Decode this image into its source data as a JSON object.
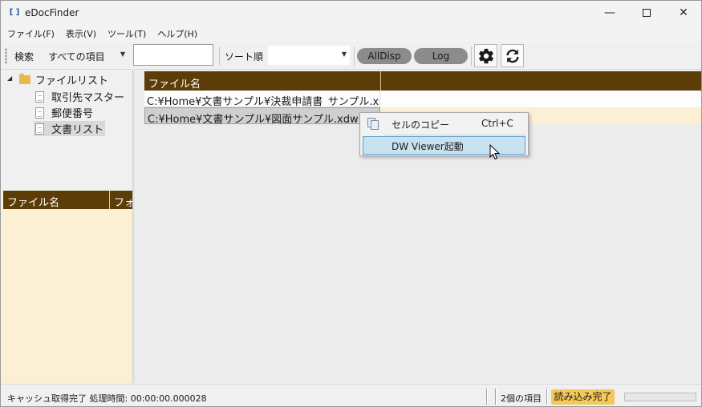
{
  "window": {
    "icon_glyph": "[ ]",
    "title": "eDocFinder",
    "minimize_glyph": "—",
    "close_glyph": "✕"
  },
  "menu": [
    "ファイル(F)",
    "表示(V)",
    "ツール(T)",
    "ヘルプ(H)"
  ],
  "toolbar": {
    "search_label": "検索",
    "scope_value": "すべての項目",
    "search_value": "",
    "sort_label": "ソート順",
    "sort_value": "",
    "alldisp_label": "AllDisp",
    "log_label": "Log",
    "settings_icon": "gear-icon",
    "refresh_icon": "refresh-icon"
  },
  "tree": {
    "root": "ファイルリスト",
    "children": [
      "取引先マスター",
      "郵便番号",
      "文書リスト"
    ],
    "selected": "文書リスト"
  },
  "left_list": {
    "columns": [
      "ファイル名",
      "フォルダ"
    ]
  },
  "grid": {
    "columns": [
      "ファイル名"
    ],
    "rows": [
      "C:¥Home¥文書サンプル¥決裁申請書_サンプル.xdw",
      "C:¥Home¥文書サンプル¥図面サンプル.xdw"
    ]
  },
  "context_menu": {
    "items": [
      {
        "label": "セルのコピー",
        "shortcut": "Ctrl+C"
      },
      {
        "label": "DW Viewer起動",
        "shortcut": ""
      }
    ]
  },
  "status": {
    "message": "キャッシュ取得完了 処理時間: 00:00:00.000028",
    "count": "2個の項目",
    "badge": "読み込み完了",
    "progress": 0
  },
  "colors": {
    "header_bg": "#5c3d08",
    "row_alt_bg": "#fcf0d4",
    "badge_bg": "#f5c85a",
    "highlight": "#c8e2f0"
  }
}
